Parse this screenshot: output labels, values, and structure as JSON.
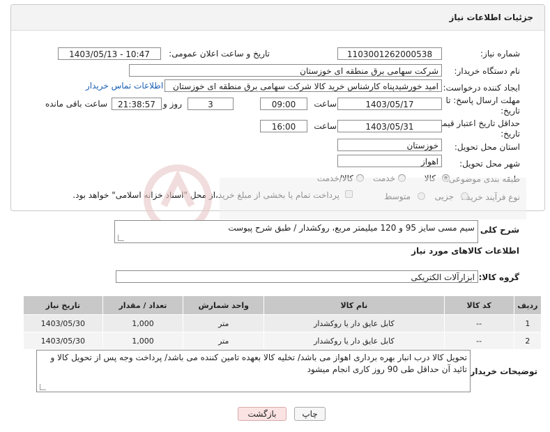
{
  "header": {
    "title": "جزئیات اطلاعات نیاز"
  },
  "form": {
    "need_number_label": "شماره نیاز:",
    "need_number": "1103001262000538",
    "announce_label": "تاریخ و ساعت اعلان عمومی:",
    "announce_value": "1403/05/13 - 10:47",
    "buyer_org_label": "نام دستگاه خریدار:",
    "buyer_org": "شرکت سهامی برق منطقه ای خوزستان",
    "creator_label": "ایجاد کننده درخواست:",
    "creator": "امید خورشیدپناه کارشناس خرید کالا شرکت سهامی برق منطقه ای خوزستان",
    "contact_link": "اطلاعات تماس خریدار",
    "deadline_label_1": "مهلت ارسال پاسخ: تا",
    "deadline_label_2": "تاریخ:",
    "deadline_date": "1403/05/17",
    "time_label": "ساعت",
    "deadline_time": "09:00",
    "days_value": "3",
    "days_label": "روز و",
    "remaining_time": "21:38:57",
    "remaining_label": "ساعت باقی مانده",
    "validity_label_1": "حداقل تاریخ اعتبار قیمت: تا",
    "validity_label_2": "تاریخ:",
    "validity_date": "1403/05/31",
    "validity_time": "16:00",
    "province_label": "استان محل تحویل:",
    "province": "خوزستان",
    "city_label": "شهر محل تحویل:",
    "city": "اهواز",
    "category_label": "طبقه بندی موضوعی:",
    "category_options": [
      "کالا",
      "خدمت",
      "کالا/خدمت"
    ],
    "category_selected": "کالا",
    "process_label": "نوع فرآیند خرید :",
    "process_options": [
      "جزیی",
      "متوسط"
    ],
    "payment_note": "پرداخت تمام یا بخشی از مبلغ خرید،از محل \"اسناد خزانه اسلامی\" خواهد بود."
  },
  "description": {
    "label": "شرح کلی نیاز:",
    "value": "سیم مسی سایز 95 و 120 میلیمتر مربع، روکشدار / طبق شرح پیوست"
  },
  "goods": {
    "section_title": "اطلاعات کالاهای مورد نیاز",
    "group_label": "گروه کالا:",
    "group_value": "ابزارآلات الکتریکی",
    "columns": [
      "ردیف",
      "کد کالا",
      "نام کالا",
      "واحد شمارش",
      "تعداد / مقدار",
      "تاریخ نیاز"
    ],
    "rows": [
      [
        "1",
        "--",
        "کابل عایق دار یا روکشدار",
        "متر",
        "1,000",
        "1403/05/30"
      ],
      [
        "2",
        "--",
        "کابل عایق دار یا روکشدار",
        "متر",
        "1,000",
        "1403/05/30"
      ]
    ]
  },
  "buyer_notes": {
    "label": "توضیحات خریدار:",
    "value": "تحویل کالا درب انبار بهره برداری اهواز می باشد/ تخلیه کالا بعهده تامین کننده می باشد/ پرداخت وجه پس از تحویل کالا و تائید آن حداقل طی 90 روز کاری انجام میشود"
  },
  "buttons": {
    "print": "چاپ",
    "back": "بازگشت"
  },
  "colors": {
    "accent_link": "#1a5fb4",
    "back_button_bg": "#fbe3e3",
    "table_header": "#c8c8c8"
  }
}
